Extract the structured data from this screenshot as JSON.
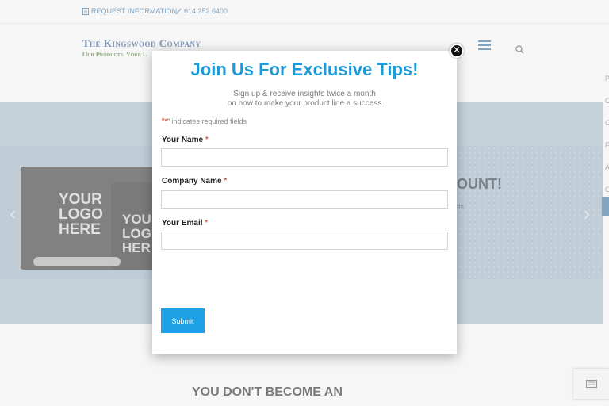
{
  "topbar": {
    "request_label": "REQUEST INFORMATION",
    "phone": "614.252.6400"
  },
  "header": {
    "logo_name": "The Kingswood Company",
    "logo_tagline": "Our Products. Your L"
  },
  "side_letters": [
    "P",
    "C",
    "C",
    "F",
    "A",
    "C"
  ],
  "hero": {
    "product_text_box": "YOUR LOGO HERE",
    "product_text_jar": "YOU LOG HER",
    "headline": "OUNT!",
    "sub": "its",
    "arrow_left": "‹",
    "arrow_right": "›"
  },
  "below": {
    "heading": "YOU DON'T BECOME AN"
  },
  "modal": {
    "close_glyph": "✕",
    "title": "Join Us For Exclusive Tips!",
    "subtitle_line1": "Sign up & receive insights twice a month",
    "subtitle_line2": "on how to make your product line a success",
    "required_note_star": "\"*\"",
    "required_note": " indicates required fields",
    "fields": [
      {
        "label": "Your Name",
        "required": "*"
      },
      {
        "label": "Company Name",
        "required": "*"
      },
      {
        "label": "Your Email",
        "required": "*"
      }
    ],
    "submit_label": "Submit"
  }
}
